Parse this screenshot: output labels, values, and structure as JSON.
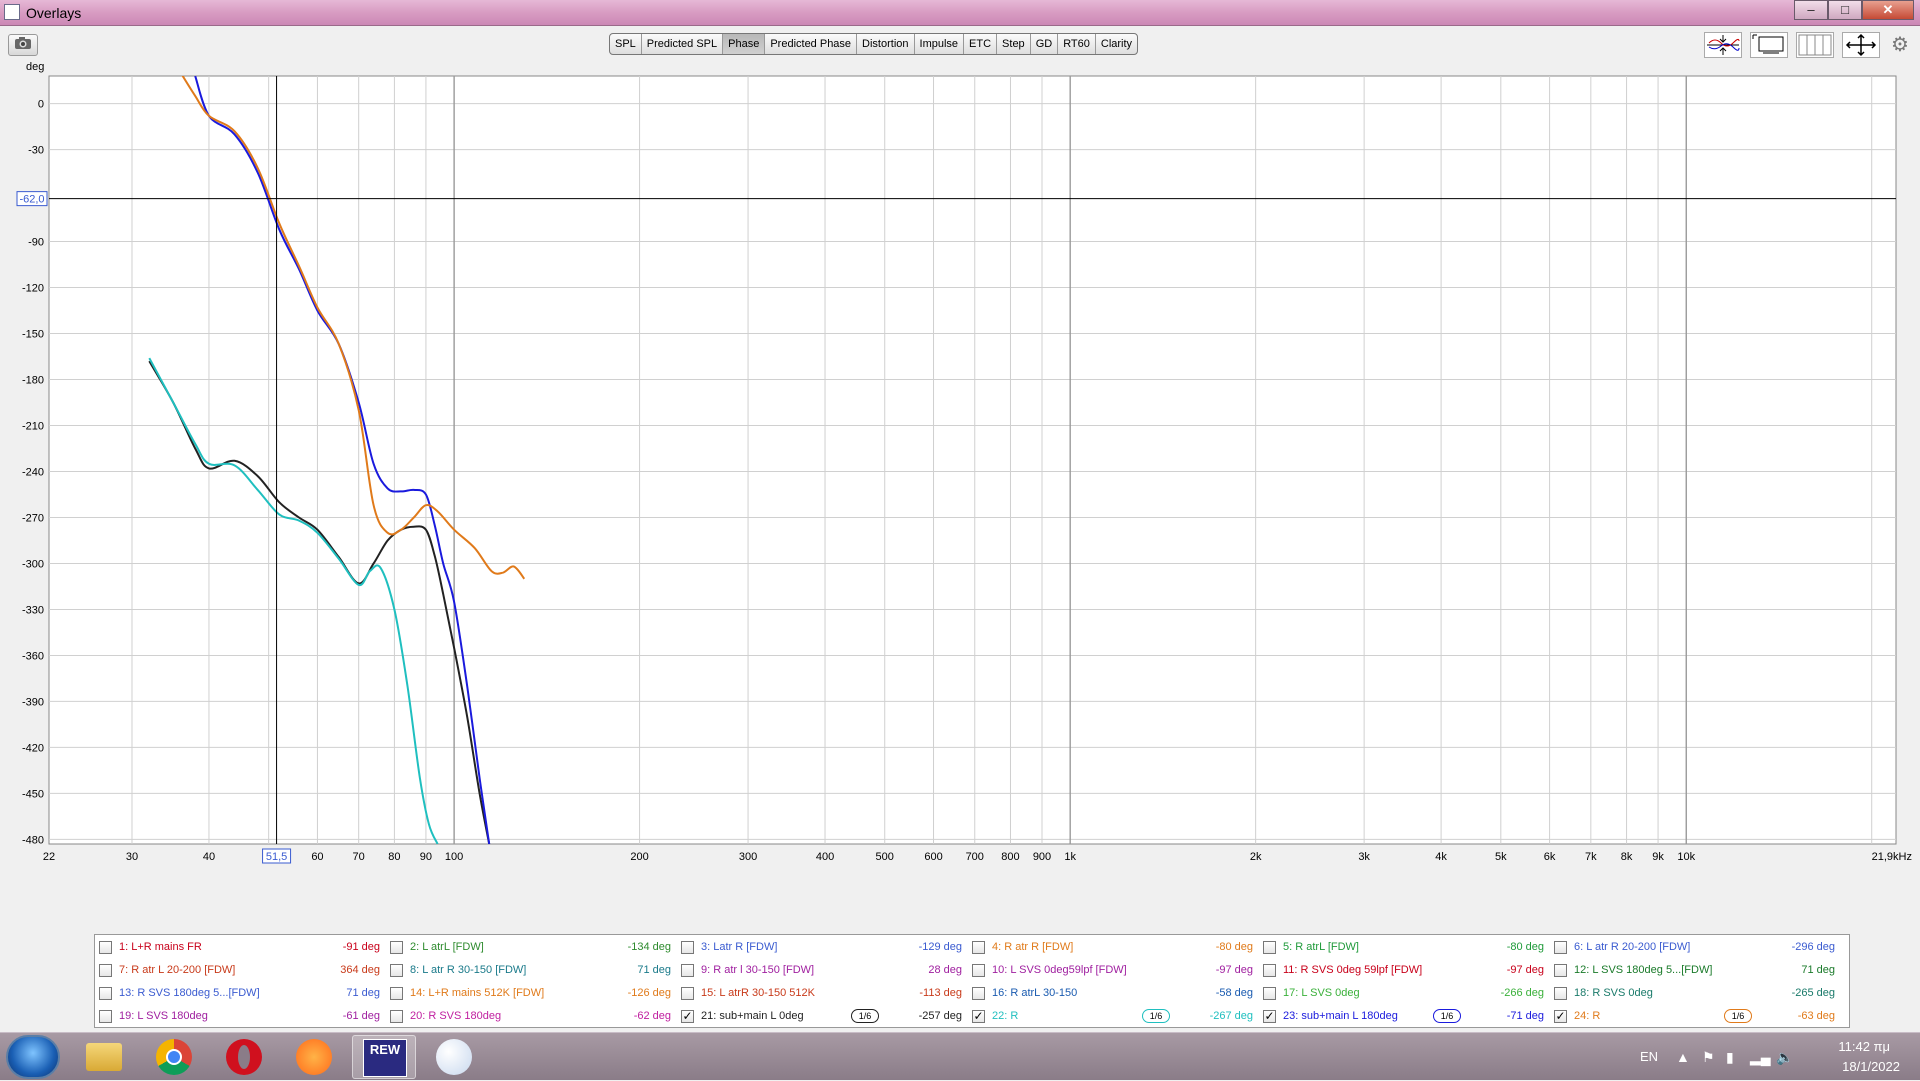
{
  "window": {
    "title": "Overlays",
    "controls": {
      "minimize": "–",
      "maximize": "□",
      "close": "✕"
    }
  },
  "toolbar": {
    "camera_icon": "camera-icon",
    "tabs": [
      {
        "label": "SPL",
        "selected": false
      },
      {
        "label": "Predicted SPL",
        "selected": false
      },
      {
        "label": "Phase",
        "selected": true
      },
      {
        "label": "Predicted Phase",
        "selected": false
      },
      {
        "label": "Distortion",
        "selected": false
      },
      {
        "label": "Impulse",
        "selected": false
      },
      {
        "label": "ETC",
        "selected": false
      },
      {
        "label": "Step",
        "selected": false
      },
      {
        "label": "GD",
        "selected": false
      },
      {
        "label": "RT60",
        "selected": false
      },
      {
        "label": "Clarity",
        "selected": false
      }
    ],
    "right_icons": [
      "align-traces-icon",
      "graph-window-icon",
      "grid-columns-icon",
      "fit-arrows-icon",
      "settings-gear-icon"
    ]
  },
  "graph": {
    "y_unit": "deg",
    "cursor_x_label": "51,5",
    "cursor_y_label": "-62,0"
  },
  "chart_data": {
    "type": "line",
    "ylabel": "deg",
    "xlabel": "",
    "xscale": "log",
    "xlim": [
      22,
      21900
    ],
    "ylim": [
      -483,
      18
    ],
    "y_ticks": [
      0,
      -30,
      -60,
      -90,
      -120,
      -150,
      -180,
      -210,
      -240,
      -270,
      -300,
      -330,
      -360,
      -390,
      -420,
      -450,
      -480
    ],
    "y_tick_labels": [
      "0",
      "-30",
      "-62,0",
      "-90",
      "-120",
      "-150",
      "-180",
      "-210",
      "-240",
      "-270",
      "-300",
      "-330",
      "-360",
      "-390",
      "-420",
      "-450",
      "-480"
    ],
    "x_ticks": [
      22,
      30,
      40,
      51.5,
      60,
      70,
      80,
      90,
      100,
      200,
      300,
      400,
      500,
      600,
      700,
      800,
      900,
      1000,
      2000,
      3000,
      4000,
      5000,
      6000,
      7000,
      8000,
      9000,
      10000,
      21900
    ],
    "x_tick_labels": [
      "22",
      "30",
      "40",
      "51,5",
      "60",
      "70",
      "80",
      "90",
      "100",
      "200",
      "300",
      "400",
      "500",
      "600",
      "700",
      "800",
      "900",
      "1k",
      "2k",
      "3k",
      "4k",
      "5k",
      "6k",
      "7k",
      "8k",
      "9k",
      "10k",
      "21,9kHz"
    ],
    "cursor": {
      "x": 51.5,
      "y": -62.0
    },
    "series": [
      {
        "name": "21: sub+main  L 0deg",
        "color": "#222222",
        "x": [
          32,
          35,
          38,
          40,
          44,
          48,
          52,
          56,
          60,
          65,
          70,
          74,
          78,
          82,
          86,
          90,
          93,
          96,
          100,
          105,
          110,
          114
        ],
        "y": [
          -168,
          -195,
          -225,
          -238,
          -233,
          -243,
          -260,
          -270,
          -278,
          -296,
          -313,
          -300,
          -285,
          -278,
          -276,
          -278,
          -295,
          -320,
          -355,
          -400,
          -450,
          -483
        ]
      },
      {
        "name": "22: R",
        "color": "#1fbfbf",
        "x": [
          32,
          35,
          38,
          40,
          44,
          48,
          52,
          56,
          60,
          65,
          70,
          73,
          76,
          80,
          84,
          88,
          91,
          94
        ],
        "y": [
          -166,
          -195,
          -222,
          -235,
          -236,
          -252,
          -268,
          -272,
          -280,
          -297,
          -314,
          -305,
          -303,
          -330,
          -380,
          -440,
          -470,
          -483
        ]
      },
      {
        "name": "23: sub+main L 180deg",
        "color": "#1a1add",
        "x": [
          38,
          40,
          44,
          48,
          52,
          56,
          60,
          65,
          70,
          74,
          78,
          82,
          86,
          90,
          93,
          96,
          100,
          105,
          110,
          114
        ],
        "y": [
          18,
          -8,
          -20,
          -45,
          -82,
          -108,
          -135,
          -157,
          -195,
          -235,
          -251,
          -253,
          -252,
          -255,
          -275,
          -300,
          -325,
          -380,
          -440,
          -483
        ]
      },
      {
        "name": "24: R",
        "color": "#e07a1a",
        "x": [
          36,
          38,
          40,
          44,
          48,
          52,
          56,
          60,
          65,
          70,
          74,
          78,
          82,
          86,
          90,
          94,
          100,
          108,
          115,
          120,
          125,
          130
        ],
        "y": [
          20,
          5,
          -8,
          -18,
          -42,
          -78,
          -106,
          -133,
          -157,
          -200,
          -262,
          -280,
          -278,
          -270,
          -262,
          -266,
          -278,
          -290,
          -305,
          -306,
          -302,
          -310
        ]
      }
    ]
  },
  "legend": {
    "items": [
      {
        "id": 1,
        "name": "1: L+R mains FR",
        "value": "-91 deg",
        "color": "#c8001a",
        "checked": false
      },
      {
        "id": 2,
        "name": "2: L atrL [FDW]",
        "value": "-134 deg",
        "color": "#2e8b2e",
        "checked": false
      },
      {
        "id": 3,
        "name": "3: Latr R [FDW]",
        "value": "-129 deg",
        "color": "#3a5bd0",
        "checked": false
      },
      {
        "id": 4,
        "name": "4: R atr R [FDW]",
        "value": "-80 deg",
        "color": "#e07a1a",
        "checked": false
      },
      {
        "id": 5,
        "name": "5: R atrL [FDW]",
        "value": "-80 deg",
        "color": "#1f9a3a",
        "checked": false
      },
      {
        "id": 6,
        "name": "6: L atr R 20-200 [FDW]",
        "value": "-296 deg",
        "color": "#3a5bd0",
        "checked": false
      },
      {
        "id": 7,
        "name": "7: R atr L 20-200 [FDW]",
        "value": "364 deg",
        "color": "#c83a1a",
        "checked": false
      },
      {
        "id": 8,
        "name": "8: L atr R 30-150 [FDW]",
        "value": "71 deg",
        "color": "#1a7a8a",
        "checked": false
      },
      {
        "id": 9,
        "name": "9: R atr l 30-150 [FDW]",
        "value": "28 deg",
        "color": "#a020a0",
        "checked": false
      },
      {
        "id": 10,
        "name": "10: L SVS 0deg59lpf [FDW]",
        "value": "-97 deg",
        "color": "#a020a0",
        "checked": false
      },
      {
        "id": 11,
        "name": "11: R SVS 0deg 59lpf [FDW]",
        "value": "-97 deg",
        "color": "#c8001a",
        "checked": false
      },
      {
        "id": 12,
        "name": "12: L SVS 180deg 5...[FDW]",
        "value": "71 deg",
        "color": "#1a7a2a",
        "checked": false
      },
      {
        "id": 13,
        "name": "13: R SVS 180deg 5...[FDW]",
        "value": "71 deg",
        "color": "#3a5bd0",
        "checked": false
      },
      {
        "id": 14,
        "name": "14: L+R mains 512K [FDW]",
        "value": "-126 deg",
        "color": "#e07a1a",
        "checked": false
      },
      {
        "id": 15,
        "name": "15: L atrR 30-150 512K",
        "value": "-113 deg",
        "color": "#c83a1a",
        "checked": false
      },
      {
        "id": 16,
        "name": "16: R atrL 30-150",
        "value": "-58 deg",
        "color": "#1a5bb0",
        "checked": false
      },
      {
        "id": 17,
        "name": "17: L SVS 0deg",
        "value": "-266 deg",
        "color": "#3ab03a",
        "checked": false
      },
      {
        "id": 18,
        "name": "18: R SVS 0deg",
        "value": "-265 deg",
        "color": "#1a7a6a",
        "checked": false
      },
      {
        "id": 19,
        "name": "19: L SVS 180deg",
        "value": "-61 deg",
        "color": "#a020a0",
        "checked": false
      },
      {
        "id": 20,
        "name": "20: R SVS 180deg",
        "value": "-62 deg",
        "color": "#c020a0",
        "checked": false
      },
      {
        "id": 21,
        "name": "21: sub+main  L 0deg",
        "value": "-257 deg",
        "color": "#222222",
        "checked": true,
        "smoothing": "1/6"
      },
      {
        "id": 22,
        "name": "22: R",
        "value": "-267 deg",
        "color": "#1fbfbf",
        "checked": true,
        "smoothing": "1/6"
      },
      {
        "id": 23,
        "name": "23: sub+main L 180deg",
        "value": "-71 deg",
        "color": "#1a1add",
        "checked": true,
        "smoothing": "1/6"
      },
      {
        "id": 24,
        "name": "24: R",
        "value": "-63 deg",
        "color": "#e07a1a",
        "checked": true,
        "smoothing": "1/6"
      }
    ]
  },
  "taskbar": {
    "apps": [
      {
        "name": "windows-start-icon"
      },
      {
        "name": "file-explorer-icon"
      },
      {
        "name": "chrome-icon"
      },
      {
        "name": "opera-icon"
      },
      {
        "name": "brave-icon"
      },
      {
        "name": "rew-app-icon",
        "active": true,
        "label": "REW"
      },
      {
        "name": "paint-icon"
      }
    ],
    "tray": {
      "language": "EN",
      "time": "11:42 πμ",
      "date": "18/1/2022"
    }
  }
}
